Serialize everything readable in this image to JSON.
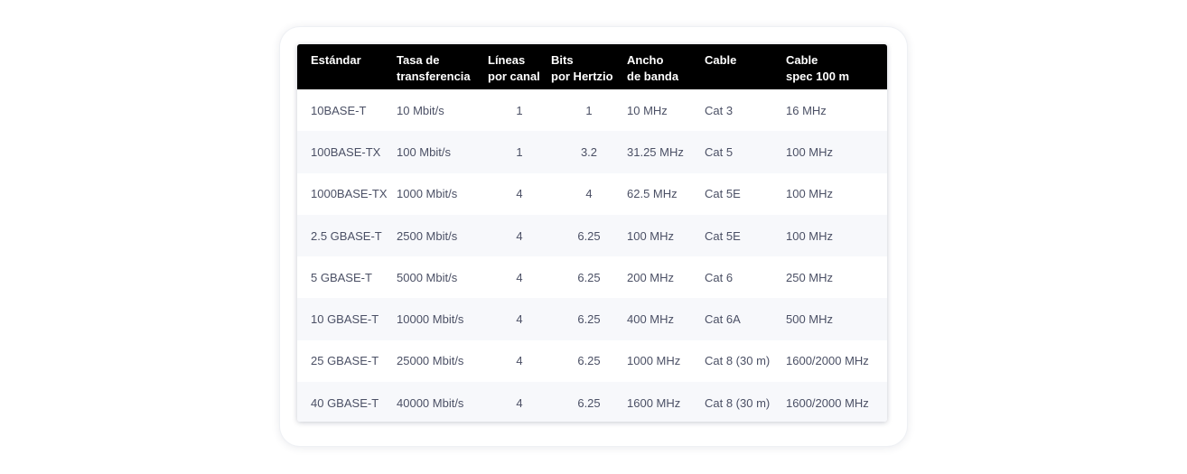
{
  "table": {
    "headers": [
      [
        "Estándar",
        ""
      ],
      [
        "Tasa de",
        "transferencia"
      ],
      [
        "Líneas",
        "por canal"
      ],
      [
        "Bits",
        "por Hertzio"
      ],
      [
        "Ancho",
        "de banda"
      ],
      [
        "Cable",
        ""
      ],
      [
        "Cable",
        "spec 100 m"
      ]
    ],
    "rows": [
      [
        "10BASE-T",
        "10 Mbit/s",
        "1",
        "1",
        "10 MHz",
        "Cat 3",
        "16 MHz"
      ],
      [
        "100BASE-TX",
        "100 Mbit/s",
        "1",
        "3.2",
        "31.25 MHz",
        "Cat 5",
        "100 MHz"
      ],
      [
        "1000BASE-TX",
        "1000 Mbit/s",
        "4",
        "4",
        "62.5 MHz",
        "Cat 5E",
        "100 MHz"
      ],
      [
        "2.5 GBASE-T",
        "2500 Mbit/s",
        "4",
        "6.25",
        "100 MHz",
        "Cat 5E",
        "100 MHz"
      ],
      [
        "5 GBASE-T",
        "5000 Mbit/s",
        "4",
        "6.25",
        "200 MHz",
        "Cat 6",
        "250 MHz"
      ],
      [
        "10 GBASE-T",
        "10000 Mbit/s",
        "4",
        "6.25",
        "400 MHz",
        "Cat 6A",
        "500 MHz"
      ],
      [
        "25 GBASE-T",
        "25000 Mbit/s",
        "4",
        "6.25",
        "1000 MHz",
        "Cat 8 (30 m)",
        "1600/2000 MHz"
      ],
      [
        "40 GBASE-T",
        "40000 Mbit/s",
        "4",
        "6.25",
        "1600 MHz",
        "Cat 8 (30 m)",
        "1600/2000 MHz"
      ]
    ]
  }
}
